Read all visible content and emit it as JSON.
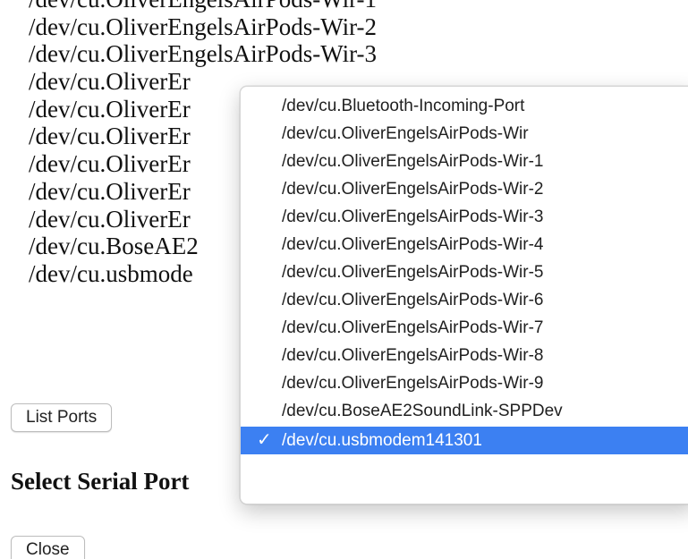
{
  "background_list": {
    "items": [
      "/dev/cu.OliverEngelsAirPods-Wir-1",
      "/dev/cu.OliverEngelsAirPods-Wir-2",
      "/dev/cu.OliverEngelsAirPods-Wir-3",
      "/dev/cu.OliverEr",
      "/dev/cu.OliverEr",
      "/dev/cu.OliverEr",
      "/dev/cu.OliverEr",
      "/dev/cu.OliverEr",
      "/dev/cu.OliverEr",
      "/dev/cu.BoseAE2",
      "/dev/cu.usbmode"
    ]
  },
  "buttons": {
    "list_ports": "List Ports",
    "close": "Close"
  },
  "select_section": {
    "title": "Select Serial Port"
  },
  "dropdown": {
    "selected_index": 12,
    "check_glyph": "✓",
    "options": [
      "/dev/cu.Bluetooth-Incoming-Port",
      "/dev/cu.OliverEngelsAirPods-Wir",
      "/dev/cu.OliverEngelsAirPods-Wir-1",
      "/dev/cu.OliverEngelsAirPods-Wir-2",
      "/dev/cu.OliverEngelsAirPods-Wir-3",
      "/dev/cu.OliverEngelsAirPods-Wir-4",
      "/dev/cu.OliverEngelsAirPods-Wir-5",
      "/dev/cu.OliverEngelsAirPods-Wir-6",
      "/dev/cu.OliverEngelsAirPods-Wir-7",
      "/dev/cu.OliverEngelsAirPods-Wir-8",
      "/dev/cu.OliverEngelsAirPods-Wir-9",
      "/dev/cu.BoseAE2SoundLink-SPPDev",
      "/dev/cu.usbmodem141301"
    ],
    "accent_color": "#3c80f2"
  }
}
